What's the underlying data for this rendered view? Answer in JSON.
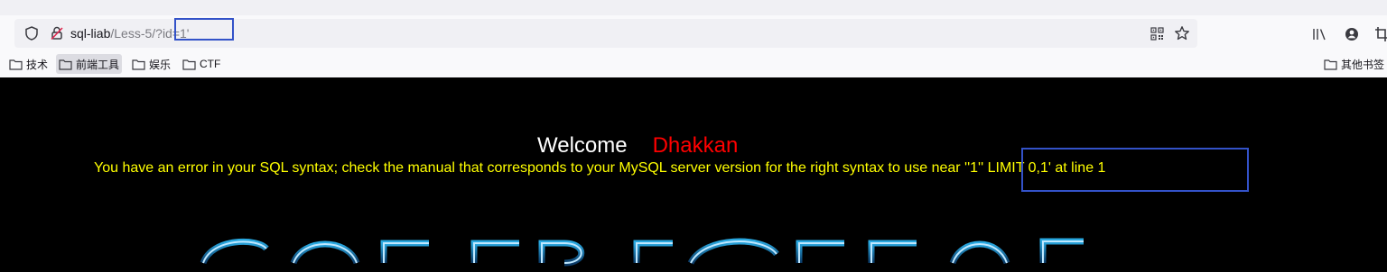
{
  "browser": {
    "url_host": "sql-liab",
    "url_path": "/Less-5/?id=1'",
    "bookmarks": [
      {
        "label": "技术"
      },
      {
        "label": "前端工具"
      },
      {
        "label": "娱乐"
      },
      {
        "label": "CTF"
      }
    ],
    "other_bookmarks": "其他书签",
    "icons": {
      "tracking": "shield-icon",
      "insecure": "insecure-lock-icon",
      "qr": "qr-code-icon",
      "bookmark": "star-icon",
      "library": "library-icon",
      "account": "account-icon",
      "screenshot": "crop-icon"
    }
  },
  "page": {
    "welcome": "Welcome",
    "name": "Dhakkan",
    "error": "You have an error in your SQL syntax; check the manual that corresponds to your MySQL server version for the right syntax to use near ''1'' LIMIT 0,1' at line 1",
    "colors": {
      "background": "#000000",
      "welcome": "#ffffff",
      "name": "#ff0000",
      "error": "#ffff00",
      "annotation_box": "#3352c8",
      "banner_glow": "#29a8e0"
    }
  }
}
